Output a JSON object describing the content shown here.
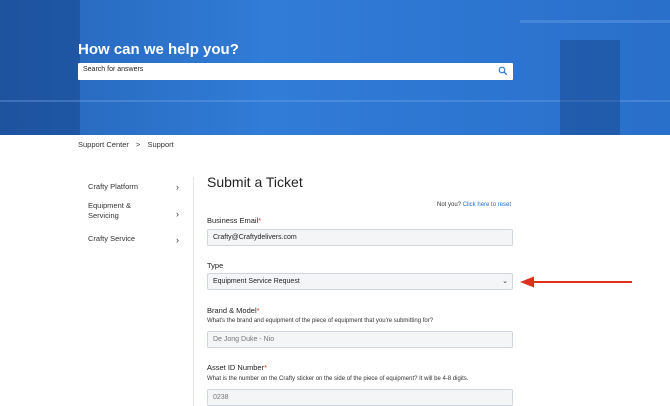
{
  "hero": {
    "title": "How can we help you?",
    "search_placeholder": "Search for answers",
    "search_icon": "search-icon",
    "background_color": "#2f7bd6"
  },
  "breadcrumb": [
    "Support Center",
    ">",
    "Support"
  ],
  "sidebar": {
    "items": [
      {
        "label": "Crafty Platform"
      },
      {
        "label": "Equipment & Servicing"
      },
      {
        "label": "Crafty Service"
      }
    ],
    "chevron_icon": "chevron-right-icon"
  },
  "form": {
    "title": "Submit a Ticket",
    "not_you": "Not you?",
    "reset_link": "Click here to reset",
    "email": {
      "label": "Business Email",
      "required": "*",
      "value": "Crafty@Craftydelivers.com"
    },
    "type": {
      "label": "Type",
      "value": "Equipment Service Request"
    },
    "brand": {
      "label": "Brand & Model",
      "required": "*",
      "help": "What's the brand and equipment of the piece of equipment that you're submitting for?",
      "placeholder": "De Jong Duke - Nio"
    },
    "asset": {
      "label": "Asset ID Number",
      "required": "*",
      "help": "What is the number on the Crafty sticker on the side of the piece of equipment? It will be 4-8 digits.",
      "placeholder": "0238"
    }
  },
  "colors": {
    "accent": "#1f6fcf",
    "required": "#e03a2f",
    "arrow": "#e0311f"
  }
}
